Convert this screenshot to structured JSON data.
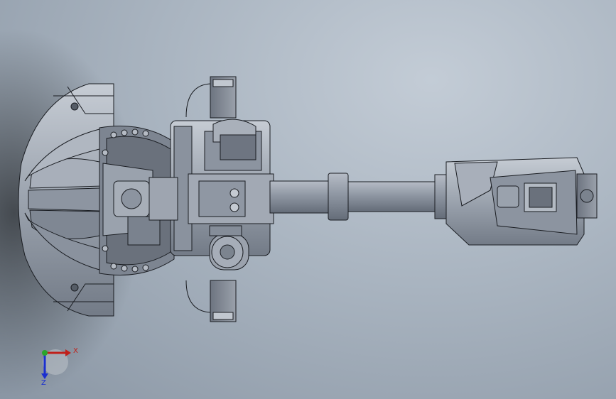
{
  "view": {
    "background_top": "#c3ccd6",
    "background_bottom": "#8a96a4",
    "model_fill": "#9aa2ae",
    "model_edge": "#1a1d22"
  },
  "triad": {
    "x_label": "X",
    "z_label": "Z",
    "x_color": "#c0201a",
    "y_color": "#2aa52a",
    "z_color": "#1a2fd0"
  }
}
